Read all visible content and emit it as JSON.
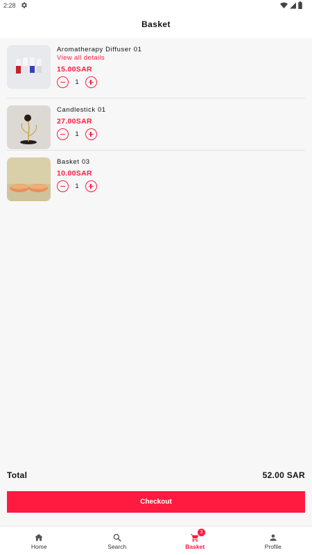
{
  "status_bar": {
    "time": "2:28"
  },
  "header": {
    "title": "Basket"
  },
  "items": [
    {
      "name": "Aromatherapy Diffuser 01",
      "details_link": "View all details",
      "price": "15.00SAR",
      "quantity": "1"
    },
    {
      "name": "Candlestick 01",
      "price": "27.00SAR",
      "quantity": "1"
    },
    {
      "name": "Basket 03",
      "price": "10.00SAR",
      "quantity": "1"
    }
  ],
  "summary": {
    "total_label": "Total",
    "total_value": "52.00 SAR"
  },
  "checkout_label": "Checkout",
  "nav": {
    "items": [
      {
        "label": "Home",
        "icon": "home-icon"
      },
      {
        "label": "Search",
        "icon": "search-icon"
      },
      {
        "label": "Basket",
        "icon": "cart-icon",
        "badge": "3",
        "active": true
      },
      {
        "label": "Profile",
        "icon": "person-icon"
      }
    ]
  },
  "colors": {
    "accent": "#ff1a40",
    "background": "#f7f7f7"
  }
}
